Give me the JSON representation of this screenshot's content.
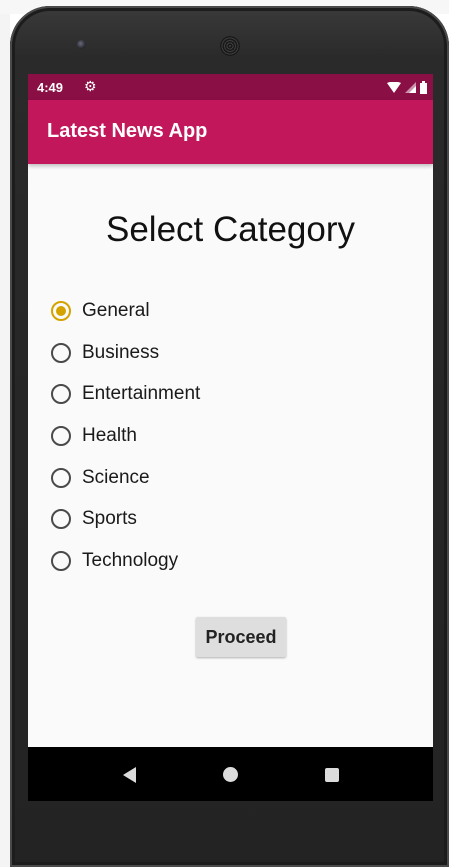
{
  "status_bar": {
    "time": "4:49",
    "settings_icon": "gear-icon",
    "wifi_icon": "wifi-icon",
    "signal_icon": "signal-icon",
    "battery_icon": "battery-icon"
  },
  "app_bar": {
    "title": "Latest News App",
    "color": "#c2185b",
    "status_color": "#8a0f45"
  },
  "main": {
    "heading": "Select Category",
    "categories": [
      {
        "label": "General",
        "selected": true
      },
      {
        "label": "Business",
        "selected": false
      },
      {
        "label": "Entertainment",
        "selected": false
      },
      {
        "label": "Health",
        "selected": false
      },
      {
        "label": "Science",
        "selected": false
      },
      {
        "label": "Sports",
        "selected": false
      },
      {
        "label": "Technology",
        "selected": false
      }
    ],
    "radio_accent": "#d4a300",
    "proceed_label": "Proceed"
  },
  "nav_bar": {
    "back_icon": "back-triangle-icon",
    "home_icon": "home-circle-icon",
    "recents_icon": "recents-square-icon"
  }
}
